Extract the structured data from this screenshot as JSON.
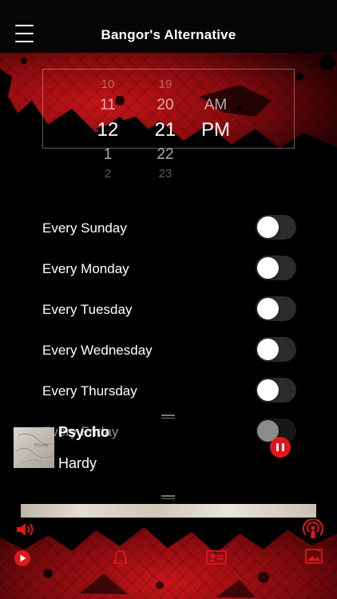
{
  "header": {
    "title": "Bangor's Alternative",
    "menu_icon": "hamburger-menu-icon"
  },
  "picker": {
    "hours": [
      "10",
      "11",
      "12",
      "1",
      "2"
    ],
    "minutes": [
      "19",
      "20",
      "21",
      "22",
      "23"
    ],
    "periods": [
      "AM",
      "PM"
    ]
  },
  "schedule": {
    "items": [
      {
        "label": "Every Sunday",
        "on": false
      },
      {
        "label": "Every Monday",
        "on": false
      },
      {
        "label": "Every Tuesday",
        "on": false
      },
      {
        "label": "Every Wednesday",
        "on": false
      },
      {
        "label": "Every Thursday",
        "on": false
      },
      {
        "label": "Every Friday",
        "on": false
      }
    ]
  },
  "now_playing": {
    "song": "Psycho",
    "artist": "Hardy"
  },
  "colors": {
    "accent": "#e0161c",
    "background": "#000000",
    "toggle_off": "#2b2b2b"
  },
  "footer_icons": [
    "volume-icon",
    "broadcast-icon",
    "play-icon",
    "bell-icon",
    "contact-card-icon",
    "photo-icon"
  ]
}
